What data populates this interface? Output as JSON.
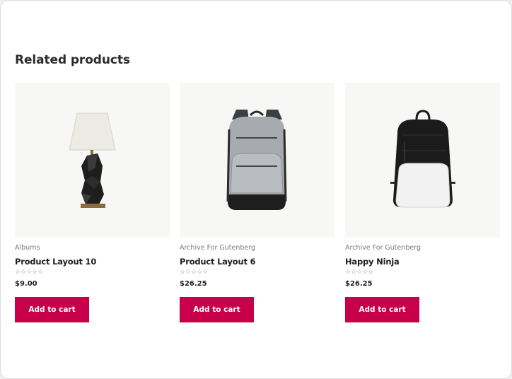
{
  "section": {
    "title": "Related products"
  },
  "products": [
    {
      "category": "Albums",
      "title": "Product Layout 10",
      "rating_stars": "☆☆☆☆☆",
      "price": "$9.00",
      "cta": "Add to cart",
      "image_icon": "table-lamp"
    },
    {
      "category": "Archive For Gutenberg",
      "title": "Product Layout 6",
      "rating_stars": "☆☆☆☆☆",
      "price": "$26.25",
      "cta": "Add to cart",
      "image_icon": "grey-backpack"
    },
    {
      "category": "Archive For Gutenberg",
      "title": "Happy Ninja",
      "rating_stars": "☆☆☆☆☆",
      "price": "$26.25",
      "cta": "Add to cart",
      "image_icon": "black-white-backpack"
    }
  ],
  "colors": {
    "button_bg": "#c8004b",
    "button_text": "#ffffff",
    "thumb_bg": "#f7f7f5"
  }
}
